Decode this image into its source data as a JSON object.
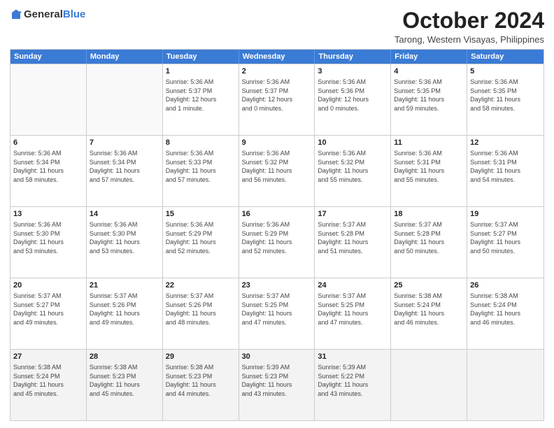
{
  "logo": {
    "general": "General",
    "blue": "Blue"
  },
  "title": "October 2024",
  "subtitle": "Tarong, Western Visayas, Philippines",
  "days": [
    "Sunday",
    "Monday",
    "Tuesday",
    "Wednesday",
    "Thursday",
    "Friday",
    "Saturday"
  ],
  "weeks": [
    [
      {
        "day": "",
        "info": ""
      },
      {
        "day": "",
        "info": ""
      },
      {
        "day": "1",
        "info": "Sunrise: 5:36 AM\nSunset: 5:37 PM\nDaylight: 12 hours\nand 1 minute."
      },
      {
        "day": "2",
        "info": "Sunrise: 5:36 AM\nSunset: 5:37 PM\nDaylight: 12 hours\nand 0 minutes."
      },
      {
        "day": "3",
        "info": "Sunrise: 5:36 AM\nSunset: 5:36 PM\nDaylight: 12 hours\nand 0 minutes."
      },
      {
        "day": "4",
        "info": "Sunrise: 5:36 AM\nSunset: 5:35 PM\nDaylight: 11 hours\nand 59 minutes."
      },
      {
        "day": "5",
        "info": "Sunrise: 5:36 AM\nSunset: 5:35 PM\nDaylight: 11 hours\nand 58 minutes."
      }
    ],
    [
      {
        "day": "6",
        "info": "Sunrise: 5:36 AM\nSunset: 5:34 PM\nDaylight: 11 hours\nand 58 minutes."
      },
      {
        "day": "7",
        "info": "Sunrise: 5:36 AM\nSunset: 5:34 PM\nDaylight: 11 hours\nand 57 minutes."
      },
      {
        "day": "8",
        "info": "Sunrise: 5:36 AM\nSunset: 5:33 PM\nDaylight: 11 hours\nand 57 minutes."
      },
      {
        "day": "9",
        "info": "Sunrise: 5:36 AM\nSunset: 5:32 PM\nDaylight: 11 hours\nand 56 minutes."
      },
      {
        "day": "10",
        "info": "Sunrise: 5:36 AM\nSunset: 5:32 PM\nDaylight: 11 hours\nand 55 minutes."
      },
      {
        "day": "11",
        "info": "Sunrise: 5:36 AM\nSunset: 5:31 PM\nDaylight: 11 hours\nand 55 minutes."
      },
      {
        "day": "12",
        "info": "Sunrise: 5:36 AM\nSunset: 5:31 PM\nDaylight: 11 hours\nand 54 minutes."
      }
    ],
    [
      {
        "day": "13",
        "info": "Sunrise: 5:36 AM\nSunset: 5:30 PM\nDaylight: 11 hours\nand 53 minutes."
      },
      {
        "day": "14",
        "info": "Sunrise: 5:36 AM\nSunset: 5:30 PM\nDaylight: 11 hours\nand 53 minutes."
      },
      {
        "day": "15",
        "info": "Sunrise: 5:36 AM\nSunset: 5:29 PM\nDaylight: 11 hours\nand 52 minutes."
      },
      {
        "day": "16",
        "info": "Sunrise: 5:36 AM\nSunset: 5:29 PM\nDaylight: 11 hours\nand 52 minutes."
      },
      {
        "day": "17",
        "info": "Sunrise: 5:37 AM\nSunset: 5:28 PM\nDaylight: 11 hours\nand 51 minutes."
      },
      {
        "day": "18",
        "info": "Sunrise: 5:37 AM\nSunset: 5:28 PM\nDaylight: 11 hours\nand 50 minutes."
      },
      {
        "day": "19",
        "info": "Sunrise: 5:37 AM\nSunset: 5:27 PM\nDaylight: 11 hours\nand 50 minutes."
      }
    ],
    [
      {
        "day": "20",
        "info": "Sunrise: 5:37 AM\nSunset: 5:27 PM\nDaylight: 11 hours\nand 49 minutes."
      },
      {
        "day": "21",
        "info": "Sunrise: 5:37 AM\nSunset: 5:26 PM\nDaylight: 11 hours\nand 49 minutes."
      },
      {
        "day": "22",
        "info": "Sunrise: 5:37 AM\nSunset: 5:26 PM\nDaylight: 11 hours\nand 48 minutes."
      },
      {
        "day": "23",
        "info": "Sunrise: 5:37 AM\nSunset: 5:25 PM\nDaylight: 11 hours\nand 47 minutes."
      },
      {
        "day": "24",
        "info": "Sunrise: 5:37 AM\nSunset: 5:25 PM\nDaylight: 11 hours\nand 47 minutes."
      },
      {
        "day": "25",
        "info": "Sunrise: 5:38 AM\nSunset: 5:24 PM\nDaylight: 11 hours\nand 46 minutes."
      },
      {
        "day": "26",
        "info": "Sunrise: 5:38 AM\nSunset: 5:24 PM\nDaylight: 11 hours\nand 46 minutes."
      }
    ],
    [
      {
        "day": "27",
        "info": "Sunrise: 5:38 AM\nSunset: 5:24 PM\nDaylight: 11 hours\nand 45 minutes."
      },
      {
        "day": "28",
        "info": "Sunrise: 5:38 AM\nSunset: 5:23 PM\nDaylight: 11 hours\nand 45 minutes."
      },
      {
        "day": "29",
        "info": "Sunrise: 5:38 AM\nSunset: 5:23 PM\nDaylight: 11 hours\nand 44 minutes."
      },
      {
        "day": "30",
        "info": "Sunrise: 5:39 AM\nSunset: 5:23 PM\nDaylight: 11 hours\nand 43 minutes."
      },
      {
        "day": "31",
        "info": "Sunrise: 5:39 AM\nSunset: 5:22 PM\nDaylight: 11 hours\nand 43 minutes."
      },
      {
        "day": "",
        "info": ""
      },
      {
        "day": "",
        "info": ""
      }
    ]
  ]
}
